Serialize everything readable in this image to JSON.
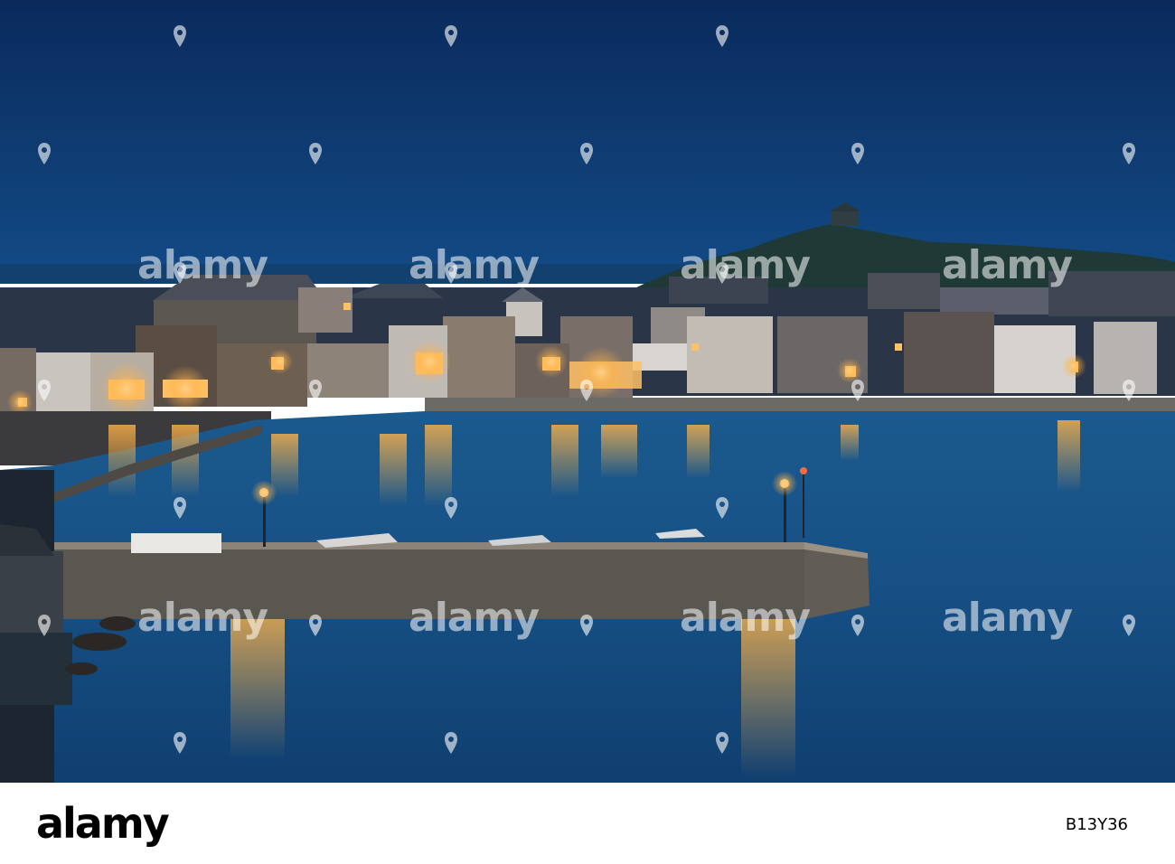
{
  "photo": {
    "subject": "Harbour town at dusk with illuminated waterfront houses, a stone pier and a headland with a chapel",
    "colors": {
      "sky_top": "#0a2a5c",
      "sky_horizon": "#134b86",
      "water": "#144a7e",
      "light_glow": "#ffb347"
    }
  },
  "watermark": {
    "text": "alamy",
    "icon": "alamy-pin-icon"
  },
  "footer": {
    "logo": "alamy",
    "image_id": "B13Y36"
  }
}
